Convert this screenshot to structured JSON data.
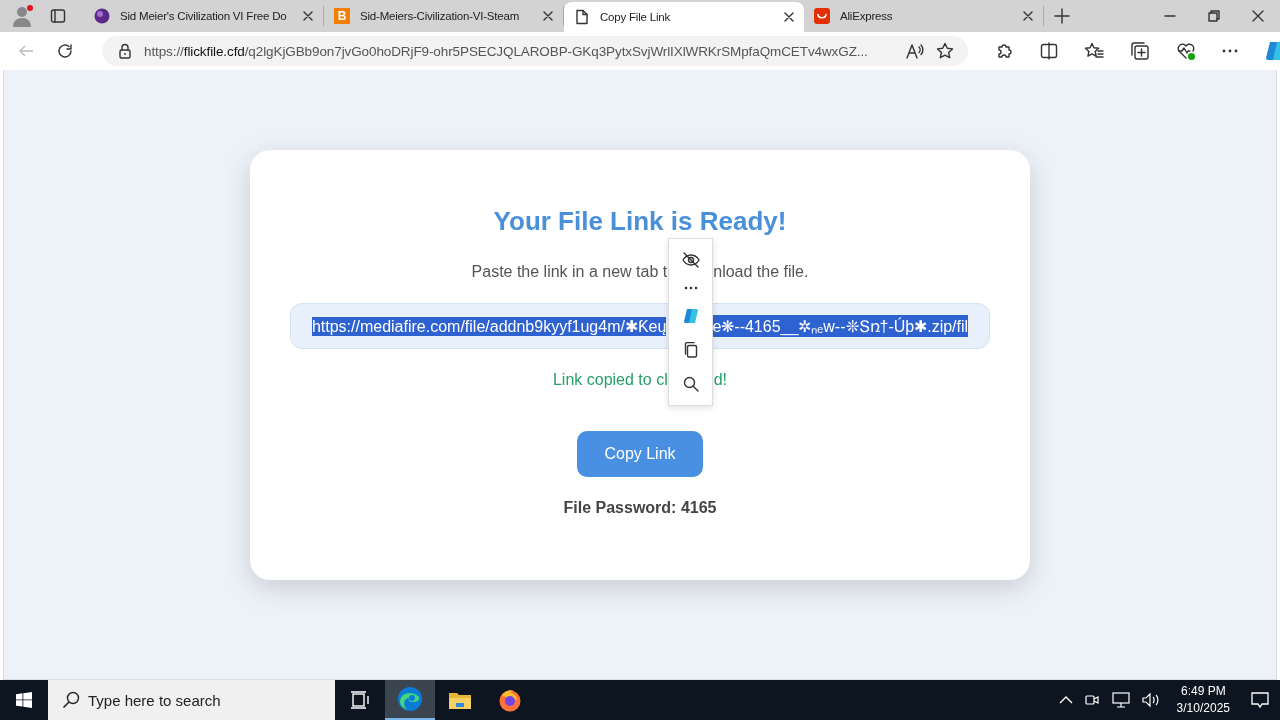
{
  "browser": {
    "tabs": [
      {
        "title": "Sid Meier's Civilization VI Free Do",
        "selected": false
      },
      {
        "title": "Sid-Meiers-Civilization-VI-Steam",
        "letter": "B",
        "selected": false
      },
      {
        "title": "Copy File Link",
        "selected": true
      },
      {
        "title": "AliExpress",
        "selected": false
      }
    ],
    "address": "https://**flickfile.cfd**/q2lgKjGBb9on7jvGo0hoDRjF9-ohr5PSECJQLAROBP-GKq3PytxSvjWrlIXlWRKrSMpfaQmCETv4wxGZ..."
  },
  "page": {
    "title": "Your File Link is Ready!",
    "instruction_parts": [
      "Paste the link in a new tab t",
      "nload the file."
    ],
    "link_parts": [
      "https://mediafire.com/file/addnb9kyyf1ug4m/✱Ƙeų",
      "e❋--4165__✲ₙₑw--❊Տռ†-Úþ✱.zip/fil"
    ],
    "link_selected": true,
    "status_parts": [
      "Link copied to cl",
      "d!"
    ],
    "button": "Copy Link",
    "password": "File Password: 4165"
  },
  "taskbar": {
    "search_placeholder": "Type here to search",
    "time": "6:49 PM",
    "date": "3/10/2025"
  }
}
